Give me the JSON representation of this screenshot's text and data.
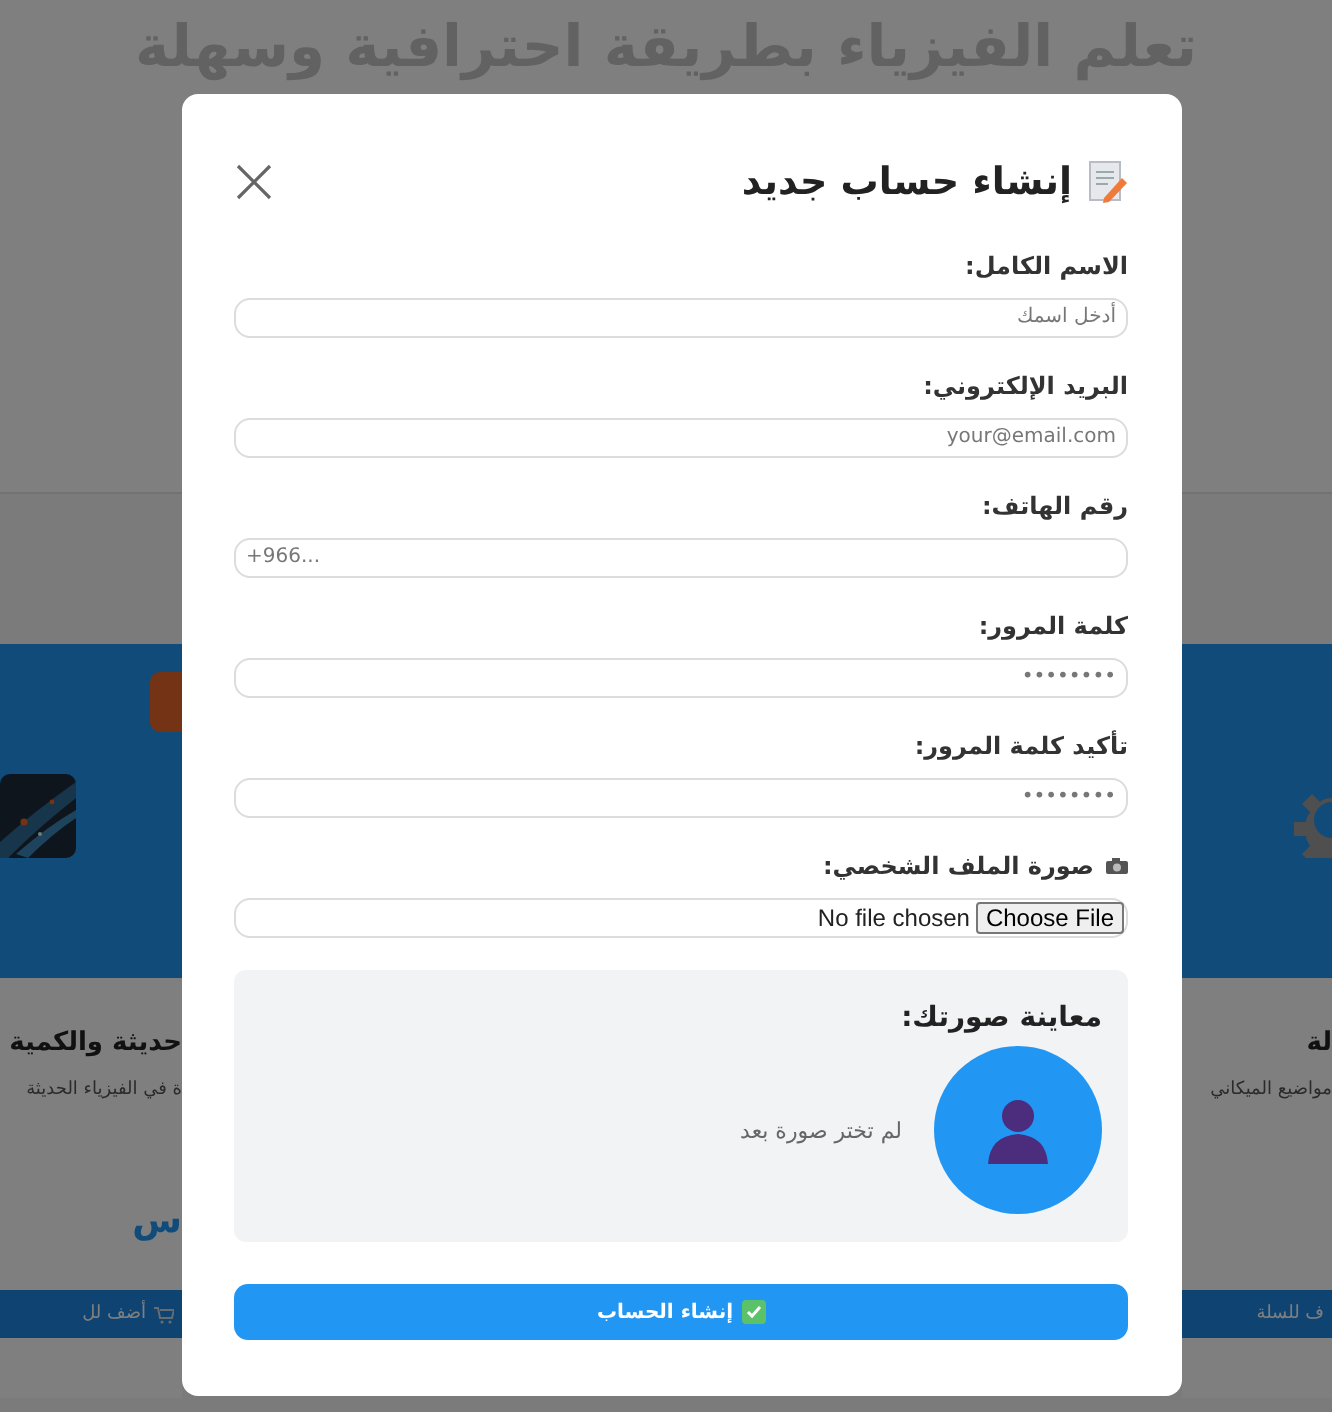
{
  "background": {
    "title": "تعلم الفيزياء بطريقة احترافية وسهلة",
    "cards": [
      {
        "kind": "gear",
        "badge": false,
        "title": "لة",
        "description": "مواضيع الميكاني",
        "button": "ف للسلة"
      },
      {
        "kind": "picture",
        "badge": true,
        "title": "حديثة والكمية",
        "description": "ة في الفيزياء الحديثة",
        "price": "س",
        "button": "أضف لل"
      }
    ]
  },
  "dialog": {
    "title": "إنشاء حساب جديد",
    "fields": [
      {
        "kind": "text",
        "label": "الاسم الكامل:",
        "placeholder": "أدخل اسمك"
      },
      {
        "kind": "email",
        "label": "البريد الإلكتروني:",
        "placeholder": "your@email.com"
      },
      {
        "kind": "phone",
        "label": "رقم الهاتف:",
        "placeholder": "+966..."
      },
      {
        "kind": "password",
        "label": "كلمة المرور:",
        "placeholder": "••••••••"
      },
      {
        "kind": "password",
        "label": "تأكيد كلمة المرور:",
        "placeholder": "••••••••"
      }
    ],
    "file_field": {
      "label": "صورة الملف الشخصي:",
      "button": "Choose File",
      "status": "No file chosen"
    },
    "preview": {
      "title": "معاينة صورتك:",
      "message": "لم تختر صورة بعد"
    },
    "submit": "إنشاء الحساب"
  }
}
